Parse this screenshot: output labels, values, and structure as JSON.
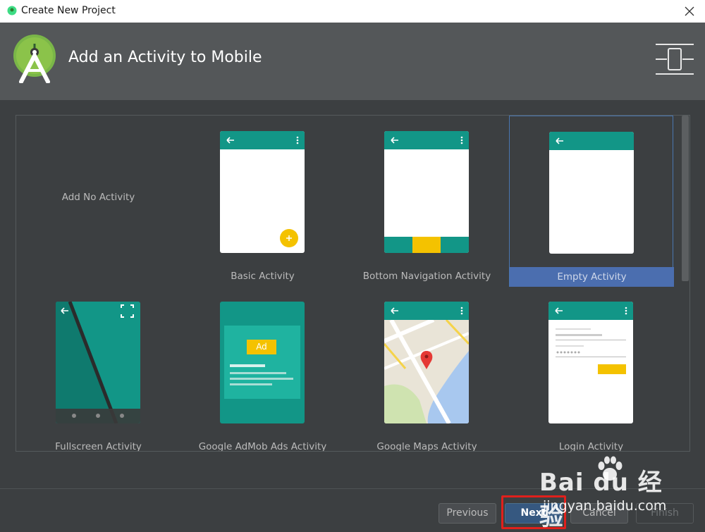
{
  "window": {
    "title": "Create New Project",
    "icon": "android-studio-icon",
    "close_icon": "close-icon"
  },
  "header": {
    "title": "Add an Activity to Mobile",
    "logo": "android-studio-logo",
    "device_icon": "phone-device-icon"
  },
  "gallery": {
    "selected": "Empty Activity",
    "tiles": [
      {
        "label": "Add No Activity"
      },
      {
        "label": "Basic Activity"
      },
      {
        "label": "Bottom Navigation Activity"
      },
      {
        "label": "Empty Activity"
      },
      {
        "label": "Fullscreen Activity"
      },
      {
        "label": "Google AdMob Ads Activity",
        "badge": "Ad"
      },
      {
        "label": "Google Maps Activity"
      },
      {
        "label": "Login Activity"
      }
    ]
  },
  "buttons": {
    "previous": "Previous",
    "next": "Next",
    "cancel": "Cancel",
    "finish": "Finish"
  },
  "watermark": {
    "brand": "Bai du 经验",
    "url": "jingyan.baidu.com"
  },
  "colors": {
    "accent_teal": "#129687",
    "selection_blue": "#4b6eaf",
    "fab_yellow": "#f4c200",
    "background": "#3c3f41",
    "header_bg": "#545759",
    "highlight_red": "#e0201c"
  }
}
